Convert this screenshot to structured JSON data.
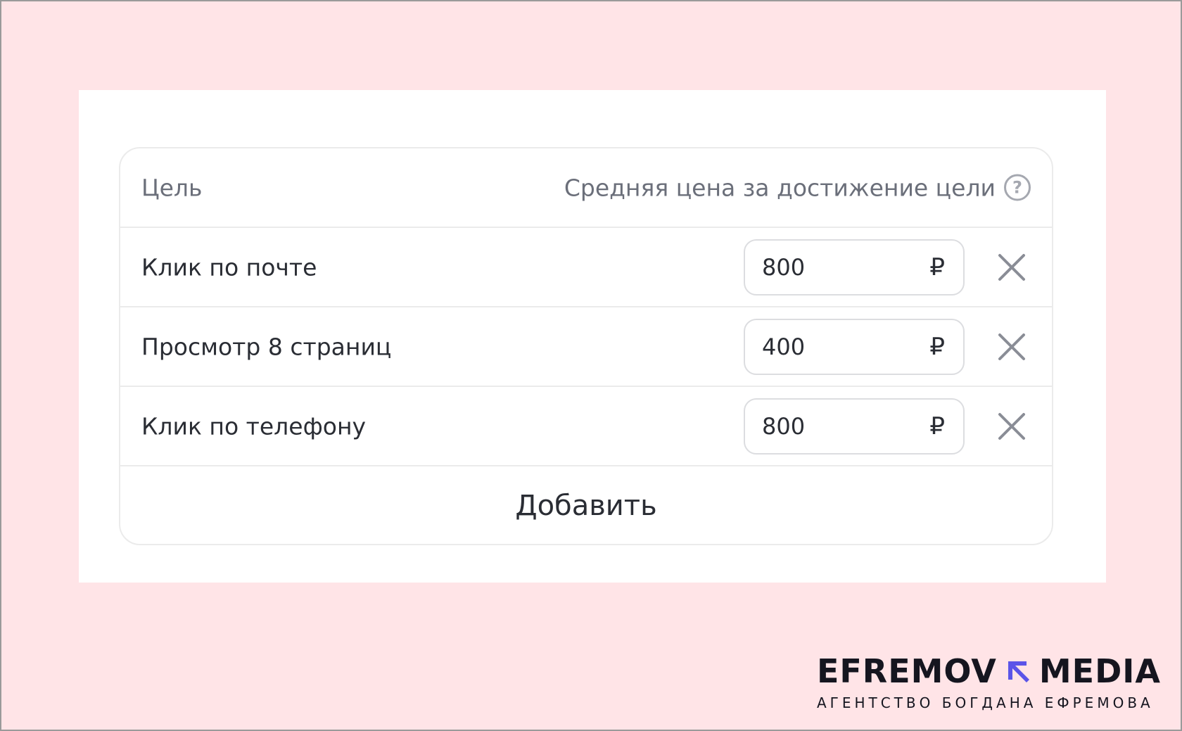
{
  "table": {
    "header": {
      "goal_label": "Цель",
      "price_label": "Средняя цена за достижение цели",
      "help_icon": "question-circle-icon"
    },
    "rows": [
      {
        "goal": "Клик по почте",
        "price": "800",
        "currency": "₽"
      },
      {
        "goal": "Просмотр 8 страниц",
        "price": "400",
        "currency": "₽"
      },
      {
        "goal": "Клик по телефону",
        "price": "800",
        "currency": "₽"
      }
    ],
    "add_label": "Добавить"
  },
  "logo": {
    "left_word": "EFREMOV",
    "right_word": "MEDIA",
    "tagline": "АГЕНТСТВО БОГДАНА ЕФРЕМОВА",
    "accent_color": "#5b54e8"
  },
  "colors": {
    "background": "#ffe4e7",
    "panel": "#ffffff",
    "border": "#ebebeb"
  }
}
